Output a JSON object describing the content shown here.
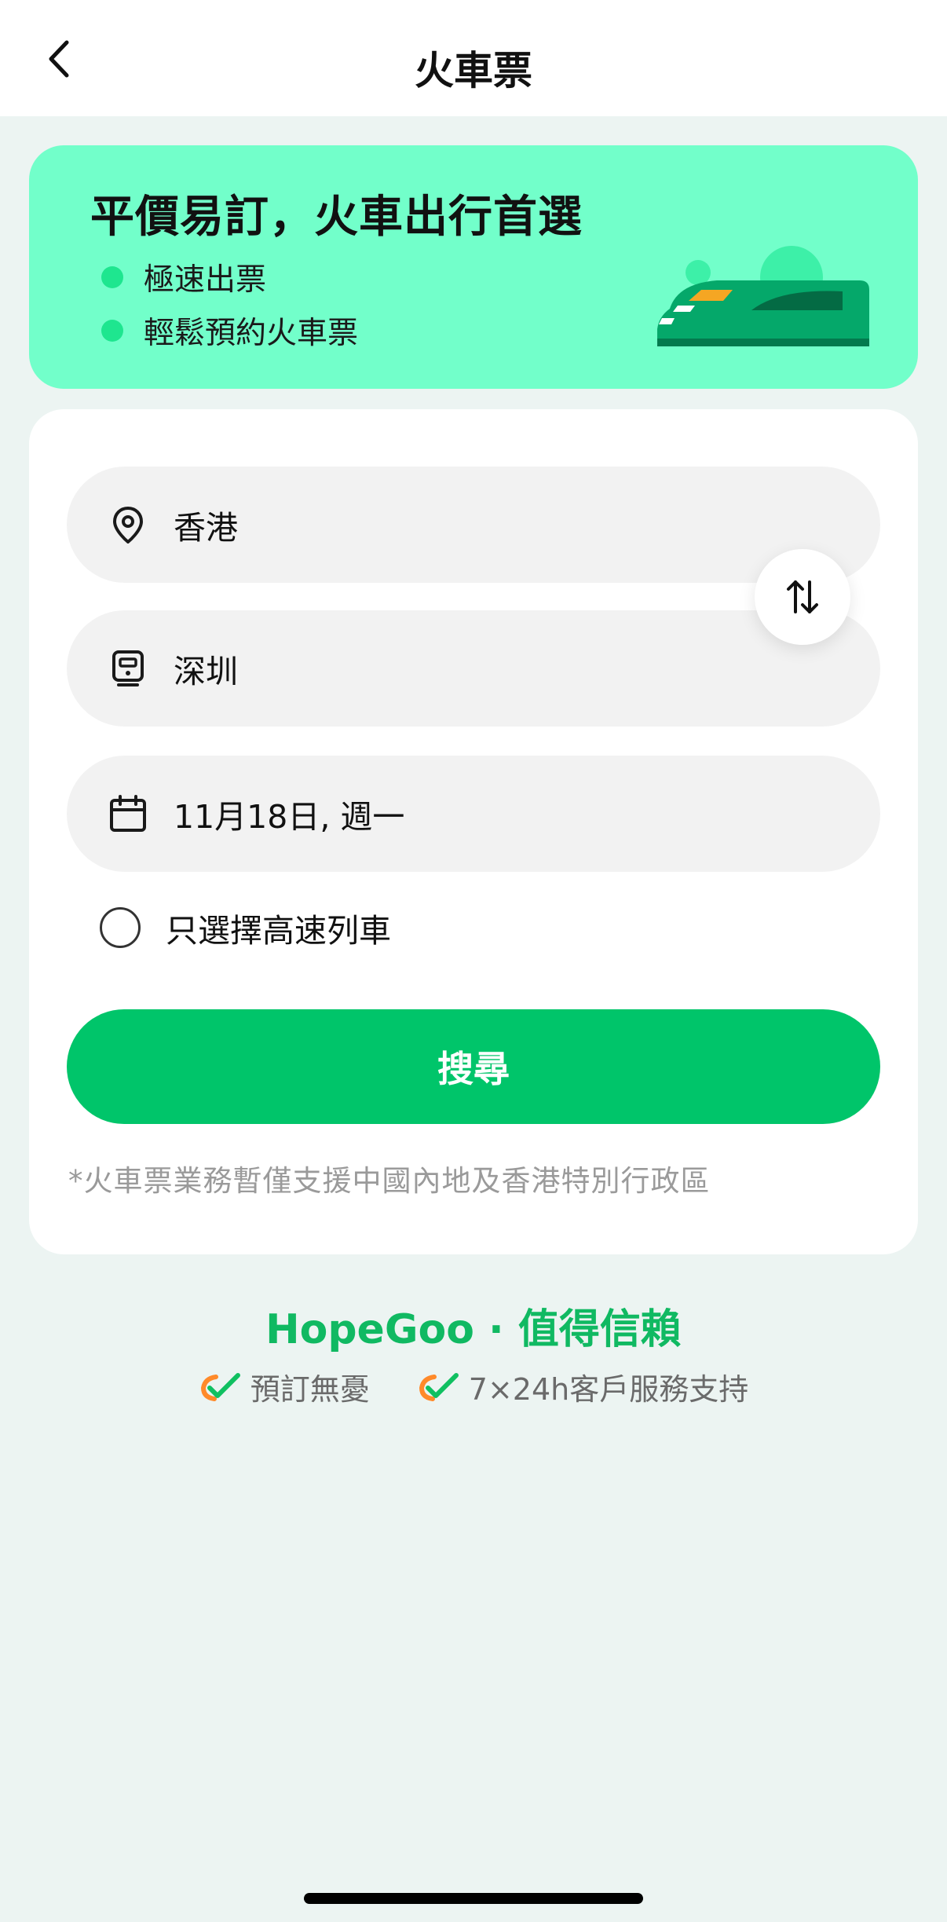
{
  "header": {
    "title": "火車票"
  },
  "banner": {
    "title": "平價易訂，火車出行首選",
    "bullets": [
      "極速出票",
      "輕鬆預約火車票"
    ]
  },
  "form": {
    "origin": "香港",
    "destination": "深圳",
    "date": "11月18日, 週一",
    "high_speed_label": "只選擇高速列車",
    "high_speed_checked": false,
    "search_label": "搜尋",
    "note": "*火車票業務暫僅支援中國內地及香港特別行政區"
  },
  "trust": {
    "title": "HopeGoo · 值得信賴",
    "items": [
      "預訂無憂",
      "7×24h客戶服務支持"
    ]
  },
  "icons": {
    "back": "chevron-left-icon",
    "origin": "location-pin-icon",
    "destination": "train-icon",
    "date": "calendar-icon",
    "swap": "swap-arrows-icon",
    "check": "check-icon"
  },
  "colors": {
    "primary": "#00c56a",
    "banner_bg": "#72ffca",
    "page_bg": "#ecf4f2",
    "accent_orange": "#ff8a2a"
  }
}
